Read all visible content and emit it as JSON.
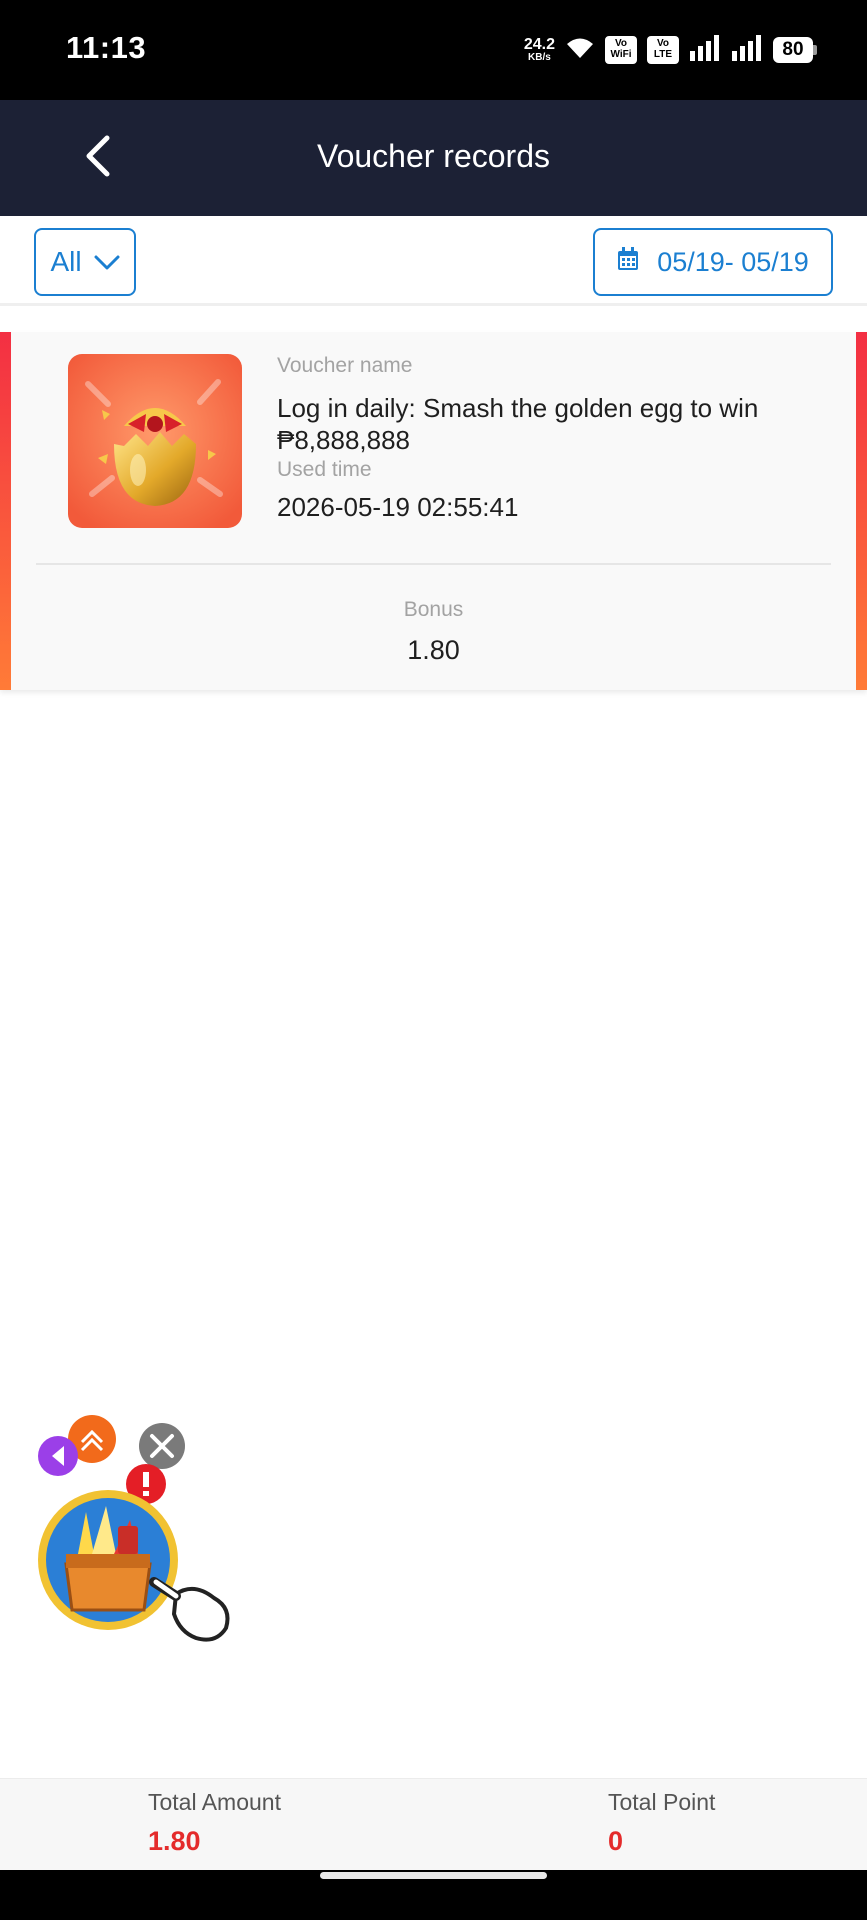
{
  "status_bar": {
    "time": "11:13",
    "net_speed_value": "24.2",
    "net_speed_unit": "KB/s",
    "chip_wifi_top": "Vo",
    "chip_wifi_bottom": "WiFi",
    "chip_lte_top": "Vo",
    "chip_lte_bottom": "LTE",
    "battery": "80",
    "icons": [
      "wifi-icon",
      "signal-icon",
      "signal-icon",
      "battery-icon"
    ]
  },
  "header": {
    "title": "Voucher records",
    "back_icon": "chevron-left-icon"
  },
  "filters": {
    "type_selected": "All",
    "date_range": "05/19- 05/19",
    "calendar_icon": "calendar-icon"
  },
  "records": [
    {
      "name_label": "Voucher name",
      "name": "Log in daily: Smash the golden egg to win ₱8,888,888",
      "time_label": "Used time",
      "used_time": "2026-05-19 02:55:41",
      "bonus_label": "Bonus",
      "bonus": "1.80",
      "thumbnail": "golden-egg-icon"
    }
  ],
  "summary": {
    "total_amount_label": "Total Amount",
    "total_amount": "1.80",
    "total_point_label": "Total Point",
    "total_point": "0"
  },
  "colors": {
    "header_bg": "#1c2135",
    "accent_blue": "#1b7fd1",
    "accent_red": "#e42b2b",
    "card_gradient_top": "#f32f43",
    "card_gradient_bottom": "#ff7b37"
  }
}
